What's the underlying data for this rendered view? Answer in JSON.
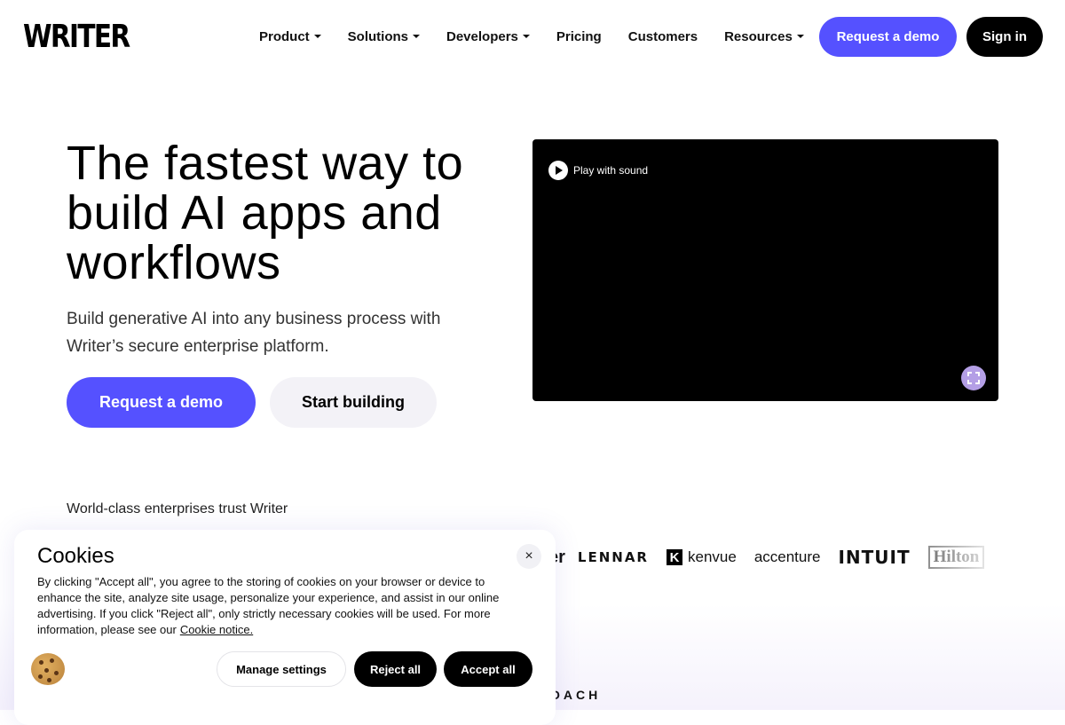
{
  "header": {
    "logo": "WRITER",
    "nav": [
      {
        "label": "Product",
        "has_dropdown": true
      },
      {
        "label": "Solutions",
        "has_dropdown": true
      },
      {
        "label": "Developers",
        "has_dropdown": true
      },
      {
        "label": "Pricing",
        "has_dropdown": false
      },
      {
        "label": "Customers",
        "has_dropdown": false
      },
      {
        "label": "Resources",
        "has_dropdown": true
      }
    ],
    "request_demo": "Request a demo",
    "sign_in": "Sign in"
  },
  "hero": {
    "title": "The fastest way to build AI apps and workflows",
    "subtitle": "Build generative AI into any business process with Writer’s secure enterprise platform.",
    "cta_primary": "Request a demo",
    "cta_secondary": "Start building"
  },
  "video": {
    "play_label": "Play with sound",
    "fullscreen_icon": "fullscreen-icon"
  },
  "trust": {
    "heading": "World-class enterprises trust Writer",
    "logos": [
      "er",
      "LENNAR",
      "kenvue",
      "accenture",
      "INTUIT",
      "Hilton"
    ]
  },
  "section_label": "OACH",
  "cookie": {
    "title": "Cookies",
    "body": "By clicking \"Accept all\", you agree to the storing of cookies on your browser or device to enhance the site, analyze site usage, personalize your experience, and assist in our online advertising. If you click \"Reject all\", only strictly necessary cookies will be used. For more information, please see our",
    "link": "Cookie notice.",
    "close": "×",
    "manage": "Manage settings",
    "reject": "Reject all",
    "accept": "Accept all"
  },
  "colors": {
    "accent": "#5551ff",
    "fullscreen_btn": "#b49fe6",
    "secondary_btn_bg": "#f3f2f7"
  }
}
